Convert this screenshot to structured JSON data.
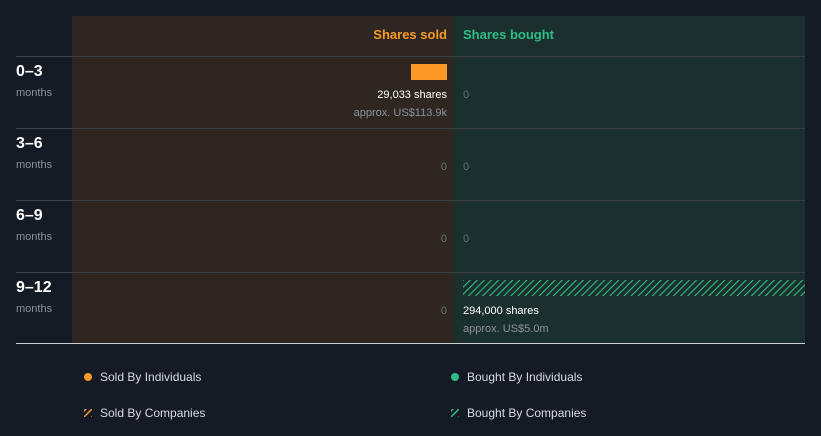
{
  "colors": {
    "background": "#151b24",
    "sold_panel": "#2e2620",
    "bought_panel": "#1b302e",
    "sold_accent": "#fb9a26",
    "bought_accent": "#2ebd85",
    "row_line": "#3a4149",
    "text": "#ffffff",
    "muted": "#8c9299"
  },
  "chart_data": {
    "type": "bar",
    "columns": {
      "sold": "Shares sold",
      "bought": "Shares bought"
    },
    "rows": [
      {
        "period": "0–3",
        "unit": "months",
        "sold": {
          "shares": 29033,
          "label": "29,033 shares",
          "approx": "approx. US$113.9k",
          "by": "individuals"
        },
        "bought": {
          "shares": 0,
          "label": "0"
        }
      },
      {
        "period": "3–6",
        "unit": "months",
        "sold": {
          "shares": 0,
          "label": "0"
        },
        "bought": {
          "shares": 0,
          "label": "0"
        }
      },
      {
        "period": "6–9",
        "unit": "months",
        "sold": {
          "shares": 0,
          "label": "0"
        },
        "bought": {
          "shares": 0,
          "label": "0"
        }
      },
      {
        "period": "9–12",
        "unit": "months",
        "sold": {
          "shares": 0,
          "label": "0"
        },
        "bought": {
          "shares": 294000,
          "label": "294,000 shares",
          "approx": "approx. US$5.0m",
          "by": "companies"
        }
      }
    ],
    "max_shares": 294000
  },
  "legend": {
    "sold_individuals": "Sold By Individuals",
    "bought_individuals": "Bought By Individuals",
    "sold_companies": "Sold By Companies",
    "bought_companies": "Bought By Companies"
  }
}
